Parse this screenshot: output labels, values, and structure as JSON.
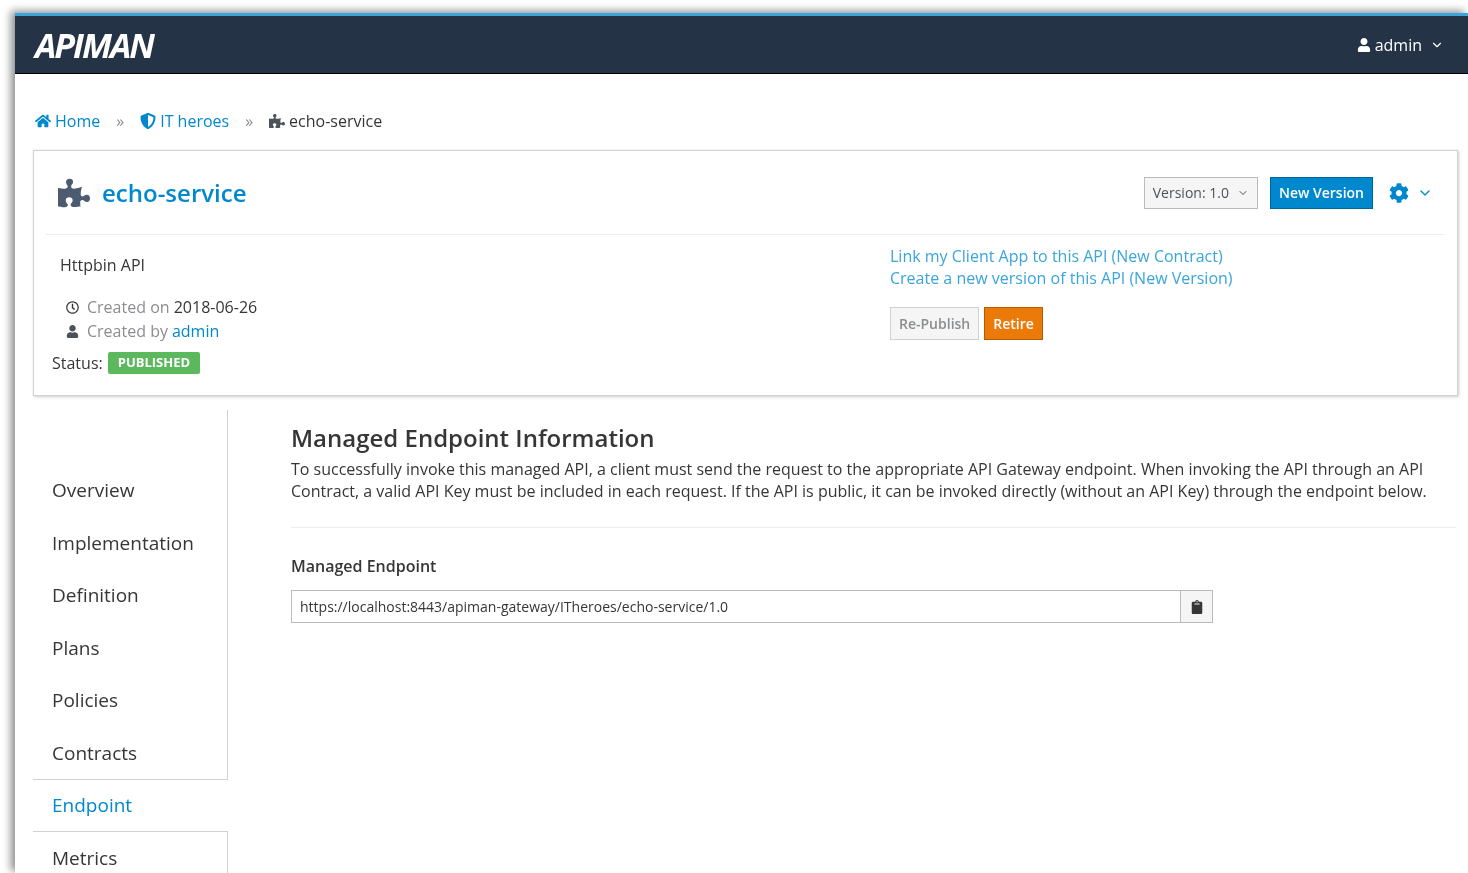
{
  "header": {
    "logo": "APIMAN",
    "user": "admin"
  },
  "breadcrumbs": [
    {
      "label": "Home",
      "kind": "home"
    },
    {
      "label": "IT heroes",
      "kind": "org"
    },
    {
      "label": "echo-service",
      "kind": "current"
    }
  ],
  "breadcrumb_separator": "»",
  "api": {
    "name": "echo-service",
    "version_label": "Version: 1.0",
    "new_version_button": "New Version",
    "description": "Httpbin API",
    "created_on_label": "Created on",
    "created_on": "2018-06-26",
    "created_by_label": "Created by",
    "created_by": "admin",
    "status_label": "Status:",
    "status": "PUBLISHED"
  },
  "links": [
    "Link my Client App to this API (New Contract)",
    "Create a new version of this API (New Version)"
  ],
  "actions": [
    {
      "label": "Re-Publish",
      "kind": "default",
      "disabled": true
    },
    {
      "label": "Retire",
      "kind": "warning",
      "disabled": false
    }
  ],
  "sidebar": {
    "items": [
      {
        "label": "Overview",
        "selected": false
      },
      {
        "label": "Implementation",
        "selected": false
      },
      {
        "label": "Definition",
        "selected": false
      },
      {
        "label": "Plans",
        "selected": false
      },
      {
        "label": "Policies",
        "selected": false
      },
      {
        "label": "Contracts",
        "selected": false
      },
      {
        "label": "Endpoint",
        "selected": true
      },
      {
        "label": "Metrics",
        "selected": false
      }
    ]
  },
  "content": {
    "title": "Managed Endpoint Information",
    "text": "To successfully invoke this managed API, a client must send the request to the appropriate API Gateway endpoint. When invoking the API through an API Contract, a valid API Key must be included in each request. If the API is public, it can be invoked directly (without an API Key) through the endpoint below.",
    "field_label": "Managed Endpoint",
    "field_value": "https://localhost:8443/apiman-gateway/ITheroes/echo-service/1.0"
  }
}
